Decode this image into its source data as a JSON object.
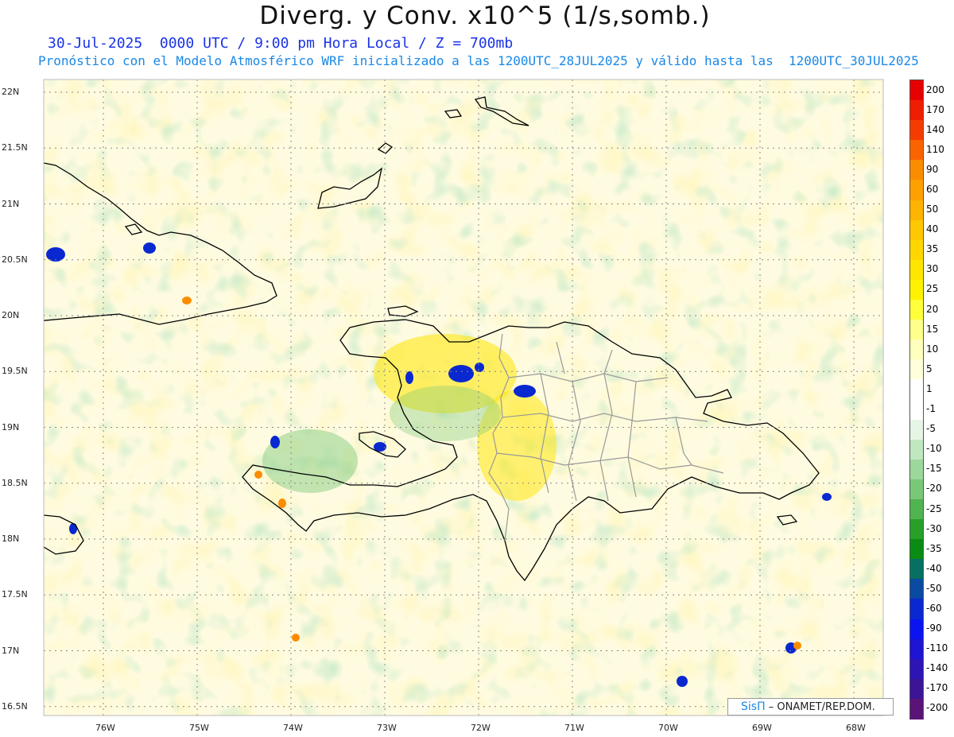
{
  "header": {
    "title": "Diverg. y Conv. x10^5 (1/s,somb.)",
    "valid_line": "30-Jul-2025  0000 UTC / 9:00 pm Hora Local / Z = 700mb",
    "model_line": "Pronóstico con el Modelo Atmosférico WRF inicializado a las 1200UTC_28JUL2025 y válido hasta las  1200UTC_30JUL2025"
  },
  "map": {
    "lat_labels": [
      "22N",
      "21.5N",
      "21N",
      "20.5N",
      "20N",
      "19.5N",
      "19N",
      "18.5N",
      "18N",
      "17.5N",
      "17N",
      "16.5N"
    ],
    "lat_values": [
      22,
      21.5,
      21,
      20.5,
      20,
      19.5,
      19,
      18.5,
      18,
      17.5,
      17,
      16.5
    ],
    "lon_labels": [
      "76W",
      "75W",
      "74W",
      "73W",
      "72W",
      "71W",
      "70W",
      "69W",
      "68W"
    ],
    "lon_values": [
      -76,
      -75,
      -74,
      -73,
      -72,
      -71,
      -70,
      -69,
      -68
    ],
    "coastline_color": "#000000",
    "border_color": "#999999"
  },
  "colorbar": {
    "labels": [
      "200",
      "170",
      "140",
      "110",
      "90",
      "60",
      "50",
      "40",
      "35",
      "30",
      "25",
      "20",
      "15",
      "10",
      "5",
      "1",
      "-1",
      "-5",
      "-10",
      "-15",
      "-20",
      "-25",
      "-30",
      "-35",
      "-40",
      "-50",
      "-60",
      "-90",
      "-110",
      "-140",
      "-170",
      "-200"
    ],
    "colors": [
      "#e60000",
      "#ef1e00",
      "#f53c00",
      "#f96400",
      "#fb8c00",
      "#fda000",
      "#feb400",
      "#ffc800",
      "#ffd700",
      "#ffe600",
      "#fff200",
      "#ffff3c",
      "#ffff8c",
      "#ffffbe",
      "#ffffdc",
      "#ffffff",
      "#ffffff",
      "#e6f5e6",
      "#c0e8c0",
      "#9cd89c",
      "#78c878",
      "#50b450",
      "#28a028",
      "#0a8c14",
      "#087060",
      "#0a4aa0",
      "#0a28d0",
      "#0a14f0",
      "#1e14d2",
      "#2d14b4",
      "#3c1496",
      "#5a1478"
    ]
  },
  "credit": {
    "logo": "SisΠ",
    "text": "– ONAMET/REP.DOM."
  }
}
